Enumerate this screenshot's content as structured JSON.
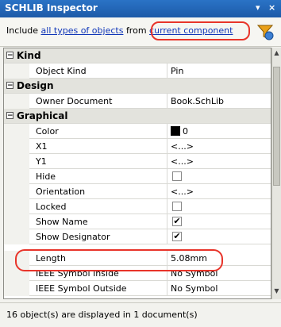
{
  "title": "SCHLIB Inspector",
  "window_controls": [
    "▾",
    "×"
  ],
  "include": {
    "prefix": "Include",
    "link1": "all types of objects",
    "middle": "from",
    "link2": "current component"
  },
  "categories": {
    "kind": "Kind",
    "design": "Design",
    "graphical": "Graphical"
  },
  "properties": {
    "object_kind": {
      "name": "Object Kind",
      "value": "Pin"
    },
    "owner_document": {
      "name": "Owner Document",
      "value": "Book.SchLib"
    },
    "color": {
      "name": "Color",
      "value": "0"
    },
    "x1": {
      "name": "X1",
      "value": "<...>"
    },
    "y1": {
      "name": "Y1",
      "value": "<...>"
    },
    "hide": {
      "name": "Hide",
      "checked": false
    },
    "orientation": {
      "name": "Orientation",
      "value": "<...>"
    },
    "locked": {
      "name": "Locked",
      "checked": false
    },
    "show_name": {
      "name": "Show Name",
      "checked": true
    },
    "show_designator": {
      "name": "Show Designator",
      "checked": true
    },
    "length": {
      "name": "Length",
      "value": "5.08mm"
    },
    "ieee_inside": {
      "name": "IEEE Symbol Inside",
      "value": "No Symbol"
    },
    "ieee_outside": {
      "name": "IEEE Symbol Outside",
      "value": "No Symbol"
    }
  },
  "status": "16 object(s) are displayed in 1 document(s)",
  "colors": {
    "titlebar": "#1d5aa8",
    "highlight": "#e8342a",
    "link": "#1036b8"
  }
}
